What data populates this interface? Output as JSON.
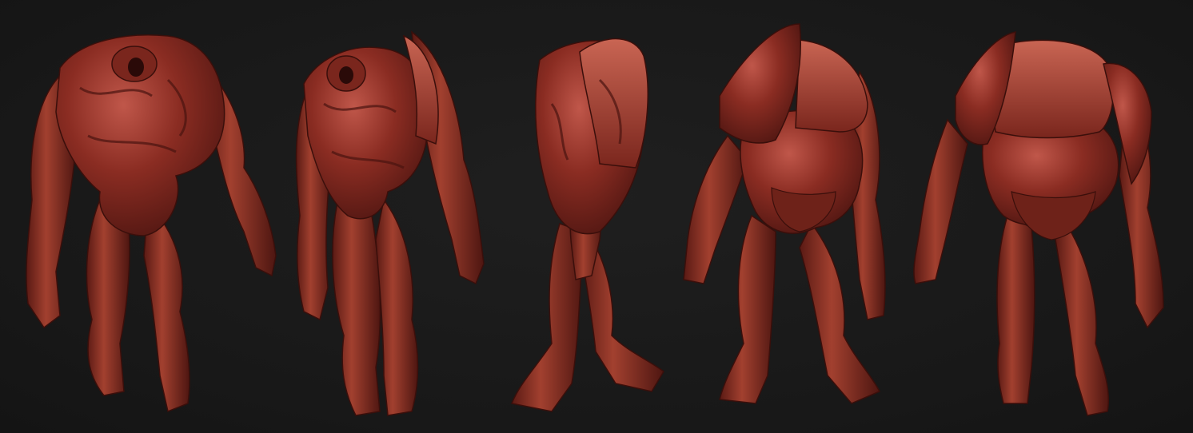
{
  "scene": {
    "background_color": "#191919",
    "clay_color": "#8a2c22",
    "clay_highlight": "#c0574a",
    "clay_shadow": "#4a1410",
    "subject": "headless-muscular-creature-sculpt",
    "views": [
      {
        "id": "front"
      },
      {
        "id": "three-quarter-front"
      },
      {
        "id": "side"
      },
      {
        "id": "three-quarter-back"
      },
      {
        "id": "back"
      }
    ]
  }
}
